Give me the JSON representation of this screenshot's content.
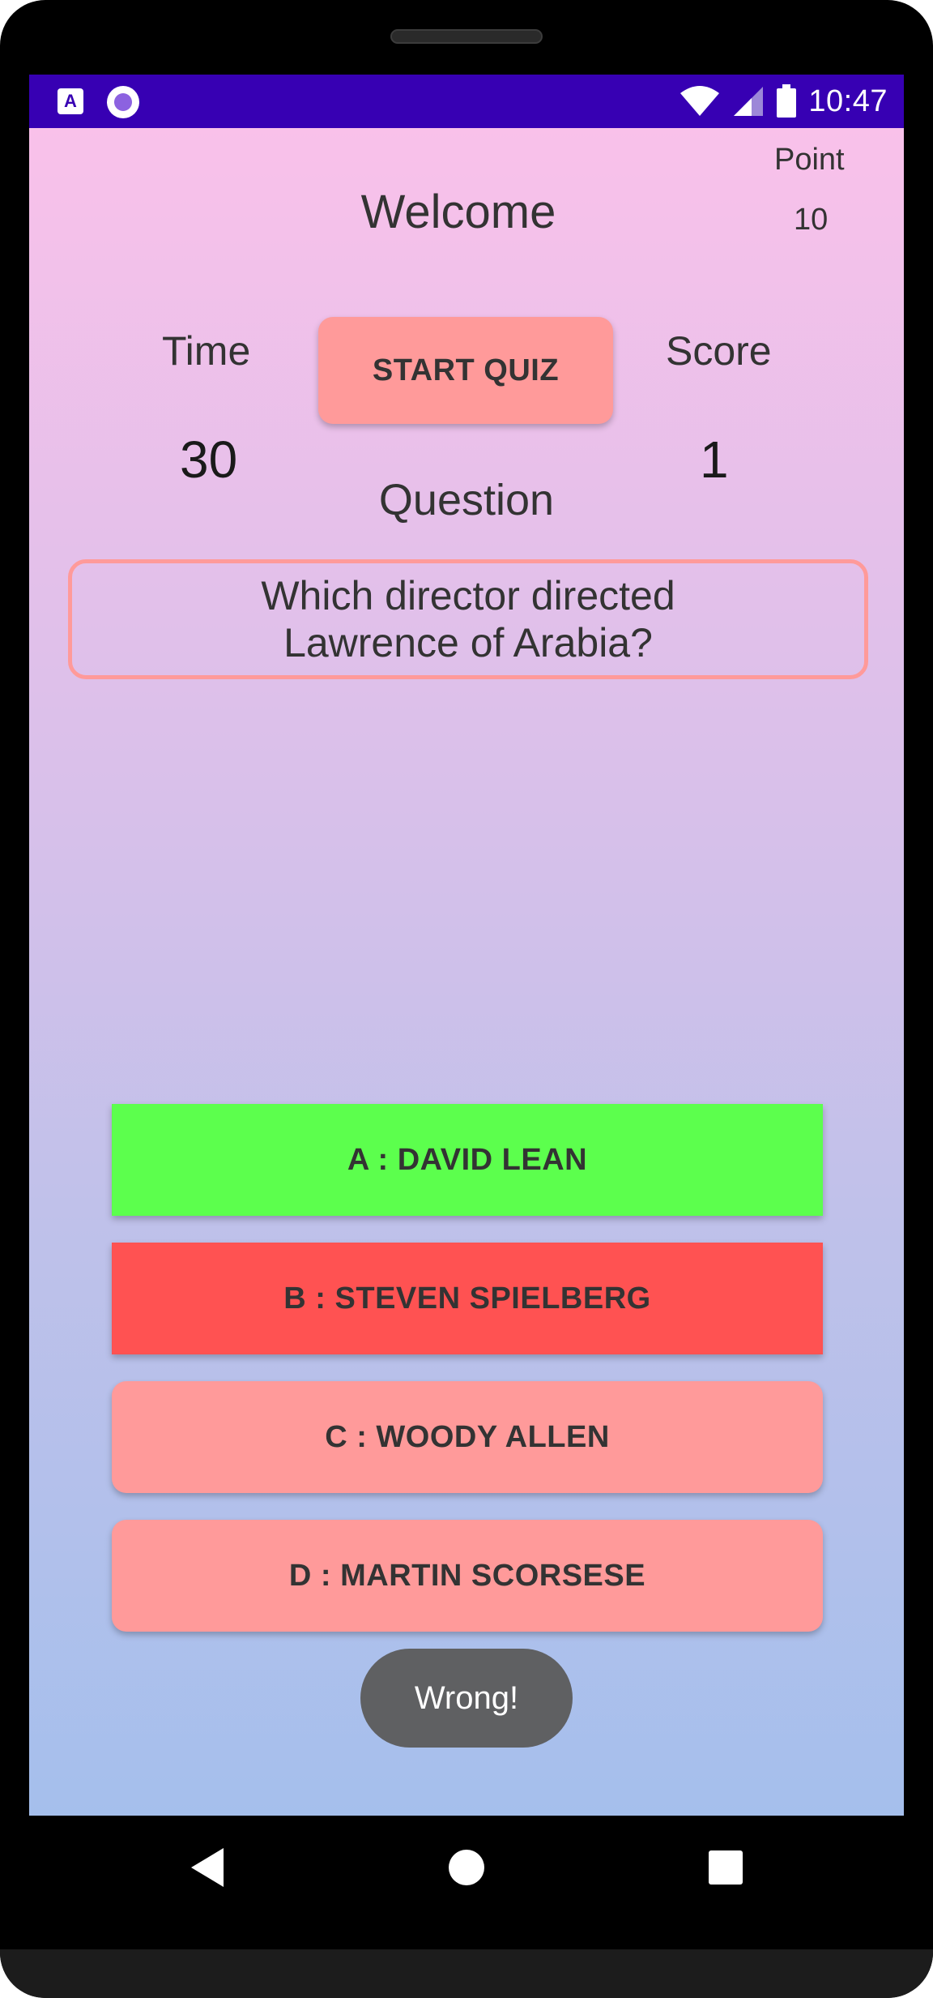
{
  "status_bar": {
    "time": "10:47",
    "icons": [
      "accessibility-a-icon",
      "circle-app-icon",
      "wifi-icon",
      "signal-icon",
      "battery-icon"
    ]
  },
  "header": {
    "welcome": "Welcome",
    "point_label": "Point",
    "point_value": "10"
  },
  "stats": {
    "time_label": "Time",
    "time_value": "30",
    "score_label": "Score",
    "score_value": "1",
    "start_button": "START QUIZ",
    "question_label": "Question"
  },
  "question": {
    "text": "Which director directed Lawrence of Arabia?"
  },
  "answers": [
    {
      "label": "A : DAVID LEAN",
      "state": "correct",
      "color": "#5cff4d"
    },
    {
      "label": "B : STEVEN SPIELBERG",
      "state": "wrong",
      "color": "#ff5252"
    },
    {
      "label": "C : WOODY ALLEN",
      "state": "default",
      "color": "#ff9a9a"
    },
    {
      "label": "D : MARTIN SCORSESE",
      "state": "default",
      "color": "#ff9a9a"
    }
  ],
  "toast": {
    "text": "Wrong!"
  },
  "theme": {
    "status_bar": "#3700b3",
    "accent": "#ff9a9a",
    "gradient_top": "#f9c1ea",
    "gradient_bottom": "#a5bfec"
  },
  "nav_bar": {
    "icons": [
      "back-icon",
      "home-icon",
      "recents-icon"
    ]
  }
}
